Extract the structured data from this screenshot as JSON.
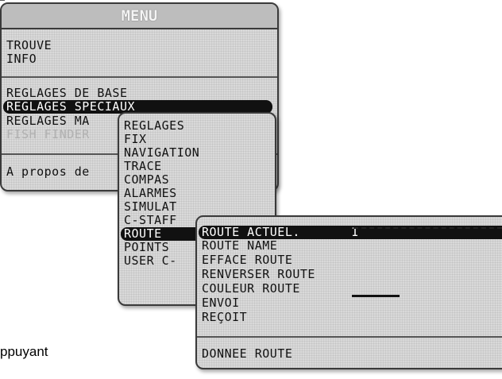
{
  "main_menu": {
    "title": "MENU",
    "items": [
      "TROUVE",
      "INFO",
      "REGLAGES DE BASE",
      "REGLAGES SPECIAUX",
      "REGLAGES MA",
      "FISH FINDER",
      "A propos de"
    ]
  },
  "submenu": {
    "items": [
      "REGLAGES",
      "FIX",
      "NAVIGATION",
      "TRACE",
      "COMPAS",
      "ALARMES",
      "SIMULAT",
      "C-STAFF",
      "ROUTE",
      "POINTS",
      "USER C-"
    ]
  },
  "route_menu": {
    "items": [
      "ROUTE ACTUEL.",
      "ROUTE NAME",
      "EFFACE ROUTE",
      "RENVERSER ROUTE",
      "COULEUR ROUTE",
      "ENVOI",
      "REÇOIT",
      "DONNEE ROUTE"
    ],
    "current_value": "1"
  },
  "caption": "ppuyant"
}
